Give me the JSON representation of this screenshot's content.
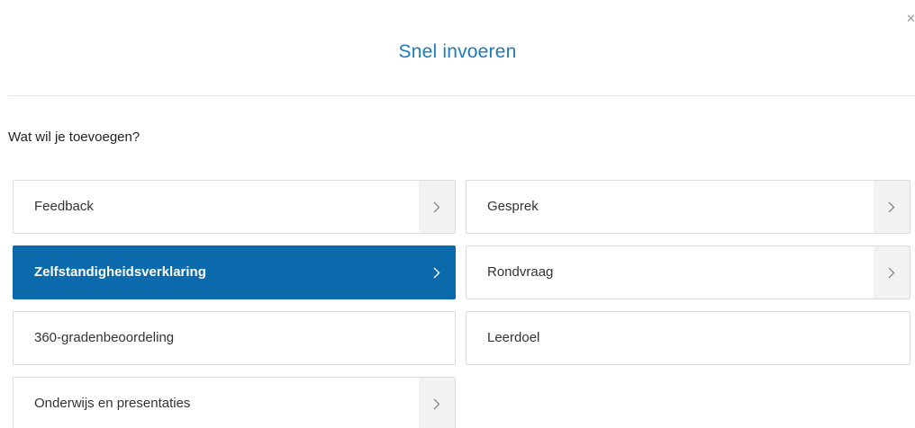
{
  "modal": {
    "title": "Snel invoeren",
    "close_icon": "close-icon",
    "question": "Wat wil je toevoegen?"
  },
  "options": [
    {
      "label": "Feedback",
      "has_chevron": true,
      "active": false
    },
    {
      "label": "Gesprek",
      "has_chevron": true,
      "active": false
    },
    {
      "label": "Zelfstandigheidsverklaring",
      "has_chevron": true,
      "active": true
    },
    {
      "label": "Rondvraag",
      "has_chevron": true,
      "active": false
    },
    {
      "label": "360-gradenbeoordeling",
      "has_chevron": false,
      "active": false
    },
    {
      "label": "Leerdoel",
      "has_chevron": false,
      "active": false
    },
    {
      "label": "Onderwijs en presentaties",
      "has_chevron": true,
      "active": false
    }
  ],
  "colors": {
    "title": "#1f7ab8",
    "active_bg": "#0a6aab",
    "chevron_bg": "#f2f2f2",
    "border": "#dcdcdc"
  }
}
